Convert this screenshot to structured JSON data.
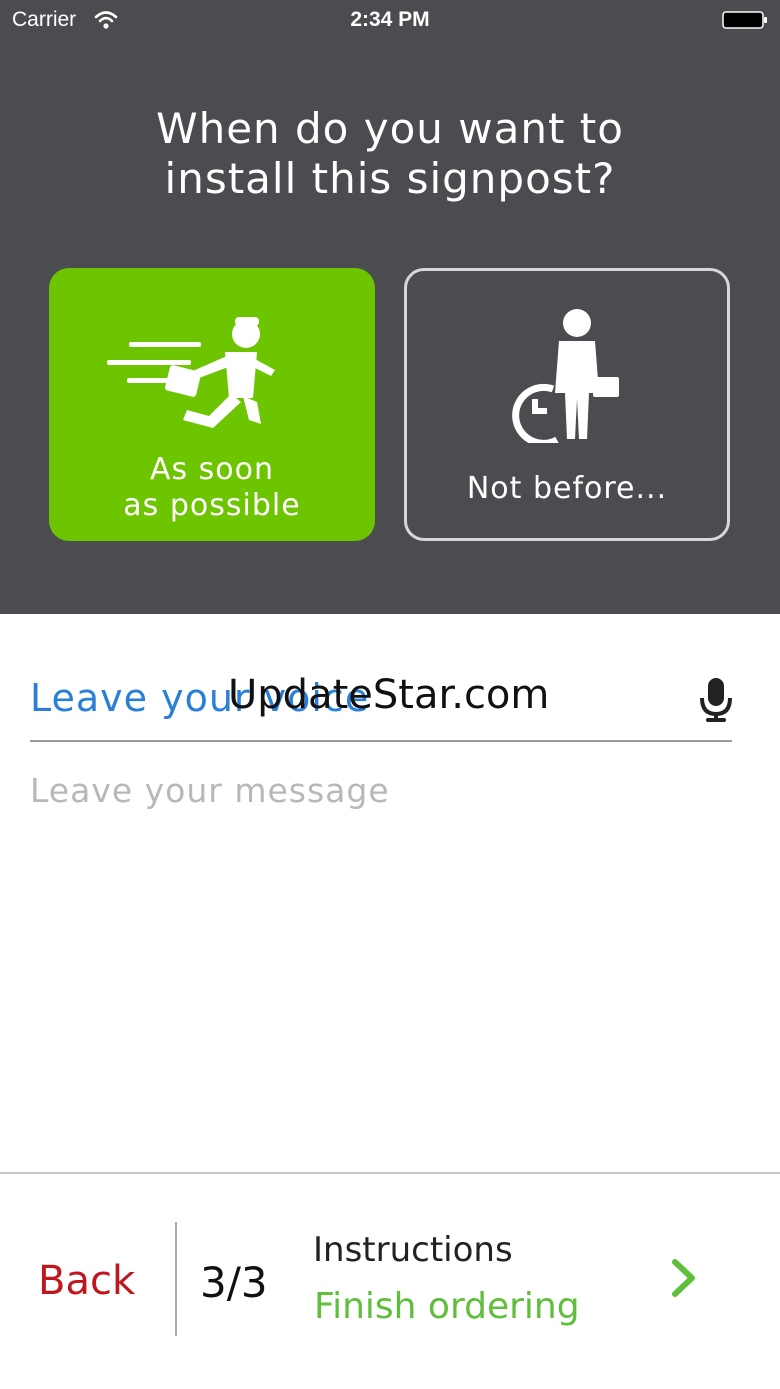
{
  "status_bar": {
    "carrier": "Carrier",
    "time": "2:34 PM"
  },
  "question": {
    "line1": "When do you want to",
    "line2": "install this signpost?"
  },
  "options": [
    {
      "line1": "As soon",
      "line2": "as possible",
      "icon": "running-delivery-man-icon",
      "selected": true
    },
    {
      "line1": "Not before...",
      "icon": "clock-businessman-icon",
      "selected": false
    }
  ],
  "voice": {
    "label": "Leave your voice",
    "icon": "microphone-icon"
  },
  "watermark": "UpdateStar.com",
  "message": {
    "placeholder": "Leave your message",
    "value": ""
  },
  "footer": {
    "back_label": "Back",
    "step": "3/3",
    "step_title": "Instructions",
    "next_label": "Finish ordering",
    "next_icon": "chevron-right-icon"
  },
  "colors": {
    "header_bg": "#4a4c50",
    "accent_green": "#6dc400",
    "finish_green": "#5fbf3a",
    "voice_blue": "#2a80d6",
    "back_red": "#c0161d"
  }
}
